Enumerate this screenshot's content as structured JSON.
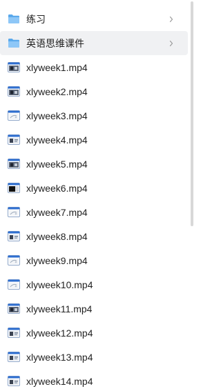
{
  "folders": [
    {
      "label": "练习",
      "hovered": false
    },
    {
      "label": "英语思维课件",
      "hovered": true
    }
  ],
  "files": [
    {
      "label": "xlyweek1.mp4",
      "thumb": "dark"
    },
    {
      "label": "xlyweek2.mp4",
      "thumb": "dark"
    },
    {
      "label": "xlyweek3.mp4",
      "thumb": "light"
    },
    {
      "label": "xlyweek4.mp4",
      "thumb": "mixed"
    },
    {
      "label": "xlyweek5.mp4",
      "thumb": "dark"
    },
    {
      "label": "xlyweek6.mp4",
      "thumb": "black"
    },
    {
      "label": "xlyweek7.mp4",
      "thumb": "light"
    },
    {
      "label": "xlyweek8.mp4",
      "thumb": "mixed"
    },
    {
      "label": "xlyweek9.mp4",
      "thumb": "light"
    },
    {
      "label": "xlyweek10.mp4",
      "thumb": "light"
    },
    {
      "label": "xlyweek11.mp4",
      "thumb": "dark"
    },
    {
      "label": "xlyweek12.mp4",
      "thumb": "mixed"
    },
    {
      "label": "xlyweek13.mp4",
      "thumb": "mixed"
    },
    {
      "label": "xlyweek14.mp4",
      "thumb": "mixed"
    }
  ],
  "icons": {
    "folder": "folder-icon",
    "video": "video-file-icon",
    "chevron": "chevron-right-icon"
  },
  "colors": {
    "folder": "#5aa9ec",
    "folder_light": "#8ec7f7",
    "hover_bg": "#f0f1f3",
    "text": "#222222",
    "chevron": "#9a9a9a",
    "video_frame": "#2f6fd0",
    "scrollbar": "#d8d8d8"
  }
}
